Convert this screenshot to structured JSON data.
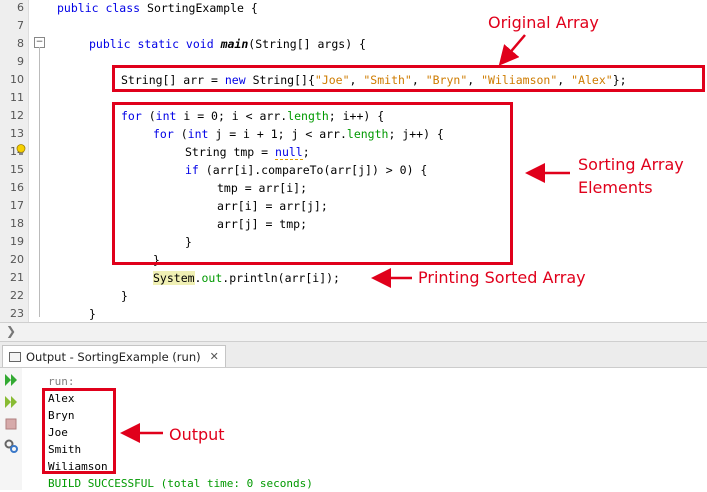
{
  "editor": {
    "line_numbers": [
      "6",
      "7",
      "8",
      "9",
      "10",
      "11",
      "12",
      "13",
      "14",
      "15",
      "16",
      "17",
      "18",
      "19",
      "20",
      "21",
      "22",
      "23"
    ],
    "code": {
      "l6": {
        "kw": "public class",
        "rest": " SortingExample {"
      },
      "l8": {
        "kw": "public static void",
        "method": "main",
        "rest": "(String[] args) {"
      },
      "l10": {
        "pre": "String[] arr = ",
        "kw": "new",
        "mid": " String[]{",
        "s1": "\"Joe\"",
        "s2": "\"Smith\"",
        "s3": "\"Bryn\"",
        "s4": "\"Wiliamson\"",
        "s5": "\"Alex\"",
        "sep": ", ",
        "end": "};"
      },
      "l12": {
        "kw1": "for",
        "a": " (",
        "kw2": "int",
        "b": " i = 0; i < arr.",
        "fld": "length",
        "c": "; i++) {"
      },
      "l13": {
        "kw1": "for",
        "a": " (",
        "kw2": "int",
        "b": " j = i + 1; j < arr.",
        "fld": "length",
        "c": "; j++) {"
      },
      "l14": {
        "pre": "String tmp = ",
        "nul": "null",
        "end": ";"
      },
      "l15": {
        "kw": "if",
        "rest": " (arr[i].compareTo(arr[j]) > 0) {"
      },
      "l16": "tmp = arr[i];",
      "l17": "arr[i] = arr[j];",
      "l18": "arr[j] = tmp;",
      "l19": "}",
      "l20": "}",
      "l21": {
        "cls": "System",
        "dot": ".",
        "fld": "out",
        "rest": ".println(arr[i]);"
      },
      "l22": "}",
      "l23": "}"
    }
  },
  "annotations": {
    "original_array": "Original Array",
    "sorting_line1": "Sorting Array",
    "sorting_line2": "Elements",
    "printing": "Printing Sorted Array",
    "output": "Output"
  },
  "output_panel": {
    "tab_label": "Output - SortingExample (run)",
    "close_glyph": "✕",
    "lines": [
      "run:",
      "Alex",
      "Bryn",
      "Joe",
      "Smith",
      "Wiliamson"
    ],
    "build_status": "BUILD SUCCESSFUL (total time: 0 seconds)"
  },
  "colors": {
    "annotation_red": "#e0001b",
    "keyword": "#0000e6",
    "string": "#ce7b00",
    "field": "#009900",
    "success": "#009900"
  }
}
